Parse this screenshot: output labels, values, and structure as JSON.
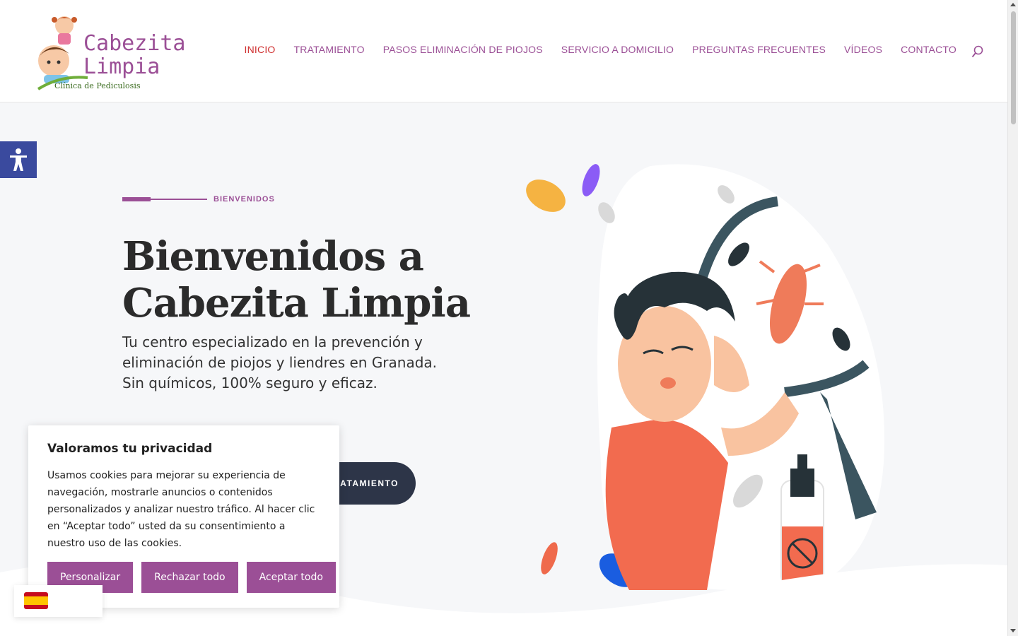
{
  "brand": {
    "name_line1": "Cabezita",
    "name_line2": "Limpia",
    "tagline": "Clínica de Pediculosis"
  },
  "nav": {
    "items": [
      "INICIO",
      "TRATAMIENTO",
      "PASOS ELIMINACIÓN DE PIOJOS",
      "SERVICIO A DOMICILIO",
      "PREGUNTAS FRECUENTES",
      "VÍDEOS",
      "CONTACTO"
    ],
    "active": "INICIO"
  },
  "hero": {
    "eyebrow": "BIENVENIDOS",
    "title": "Bienvenidos a Cabezita Limpia",
    "subtitle": "Tu centro especializado en la prevención y eliminación de piojos y liendres en Granada. Sin químicos, 100% seguro y eficaz.",
    "button_label_visible": "RATAMIENTO"
  },
  "cookie": {
    "title": "Valoramos tu privacidad",
    "text": "Usamos cookies para mejorar su experiencia de navegación, mostrarle anuncios o contenidos personalizados y analizar nuestro tráfico. Al hacer clic en “Aceptar todo” usted da su consentimiento a nuestro uso de las cookies.",
    "buttons": {
      "customize": "Personalizar",
      "reject": "Rechazar todo",
      "accept": "Aceptar todo"
    }
  },
  "colors": {
    "brand_purple": "#9b4f96",
    "active_red": "#cf2e2e",
    "button_dark": "#2d3548",
    "a11y_blue": "#3a4a9e"
  },
  "icons": {
    "search": "search-icon",
    "accessibility": "accessibility-icon",
    "language_flag": "spain-flag-icon"
  }
}
